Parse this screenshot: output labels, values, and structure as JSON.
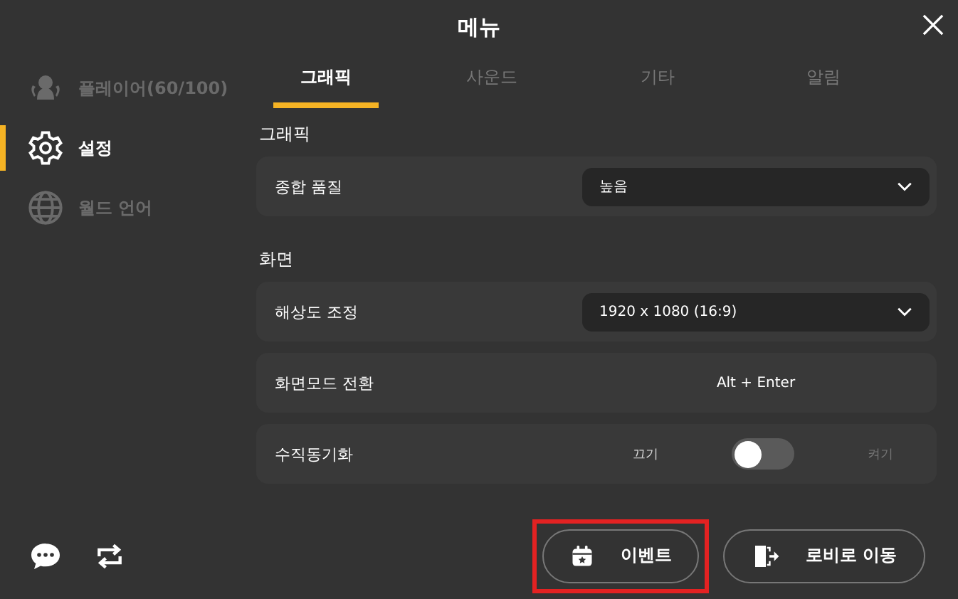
{
  "window": {
    "title": "메뉴"
  },
  "sidebar": {
    "items": [
      {
        "label": "플레이어(60/100)",
        "kind": "players",
        "selected": false
      },
      {
        "label": "설정",
        "kind": "settings",
        "selected": true
      },
      {
        "label": "월드 언어",
        "kind": "language",
        "selected": false
      }
    ]
  },
  "tabs": [
    {
      "label": "그래픽",
      "selected": true
    },
    {
      "label": "사운드",
      "selected": false
    },
    {
      "label": "기타",
      "selected": false
    },
    {
      "label": "알림",
      "selected": false
    }
  ],
  "sections": [
    {
      "title": "그래픽",
      "rows": [
        {
          "kind": "dropdown",
          "label": "종합 품질",
          "value": "높음"
        }
      ]
    },
    {
      "title": "화면",
      "rows": [
        {
          "kind": "dropdown",
          "label": "해상도 조정",
          "value": "1920 x 1080 (16:9)"
        },
        {
          "kind": "text",
          "label": "화면모드 전환",
          "value": "Alt + Enter"
        },
        {
          "kind": "toggle",
          "label": "수직동기화",
          "off_label": "끄기",
          "on_label": "켜기",
          "on": false
        }
      ]
    }
  ],
  "footer": {
    "buttons": [
      {
        "label": "이벤트",
        "kind": "event",
        "highlighted": true
      },
      {
        "label": "로비로 이동",
        "kind": "lobby",
        "highlighted": false
      }
    ]
  }
}
